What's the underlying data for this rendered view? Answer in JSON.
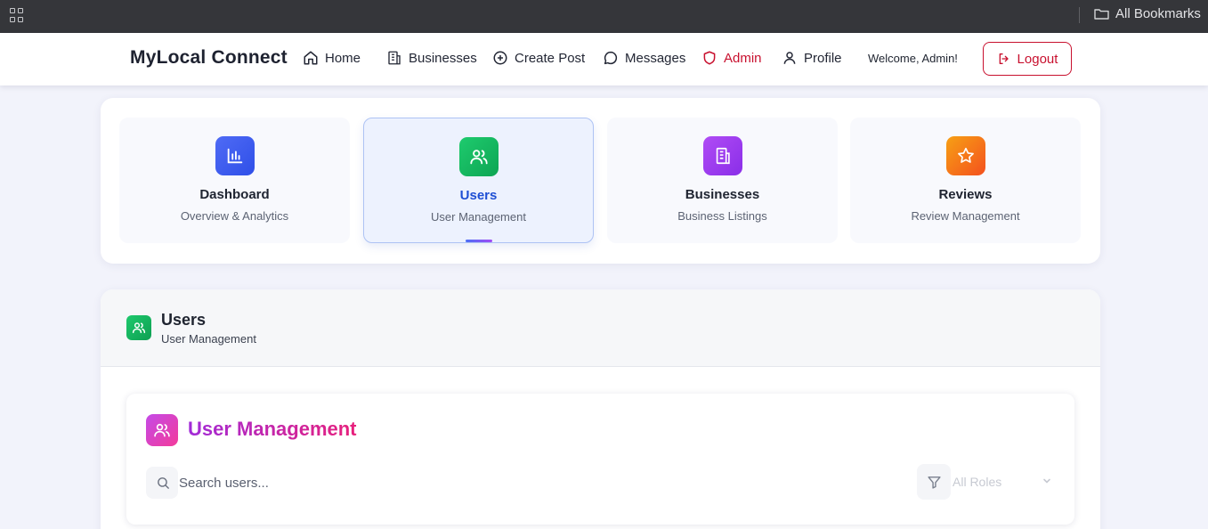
{
  "browser": {
    "bookmarks_label": "All Bookmarks"
  },
  "navbar": {
    "brand": "MyLocal Connect",
    "items": [
      {
        "label": "Home",
        "icon": "home-icon"
      },
      {
        "label": "Businesses",
        "icon": "building-icon"
      },
      {
        "label": "Create Post",
        "icon": "plus-circle-icon"
      },
      {
        "label": "Messages",
        "icon": "message-icon"
      },
      {
        "label": "Admin",
        "icon": "shield-icon"
      },
      {
        "label": "Profile",
        "icon": "user-icon"
      }
    ],
    "welcome": "Welcome, Admin!",
    "logout": "Logout"
  },
  "tabs": [
    {
      "title": "Dashboard",
      "subtitle": "Overview & Analytics",
      "icon": "bar-chart-icon",
      "color": "#3b5bf0"
    },
    {
      "title": "Users",
      "subtitle": "User Management",
      "icon": "users-icon",
      "color": "#10b45c",
      "active": true
    },
    {
      "title": "Businesses",
      "subtitle": "Business Listings",
      "icon": "building-icon",
      "color": "#9b3ff0"
    },
    {
      "title": "Reviews",
      "subtitle": "Review Management",
      "icon": "star-icon",
      "color": "#f97316"
    }
  ],
  "section": {
    "title": "Users",
    "subtitle": "User Management"
  },
  "user_management": {
    "title": "User Management",
    "search_placeholder": "Search users...",
    "role_filter": "All Roles"
  },
  "colors": {
    "accent": "#1e4fd4",
    "admin": "#c8102e",
    "background": "#f2f3fb"
  }
}
